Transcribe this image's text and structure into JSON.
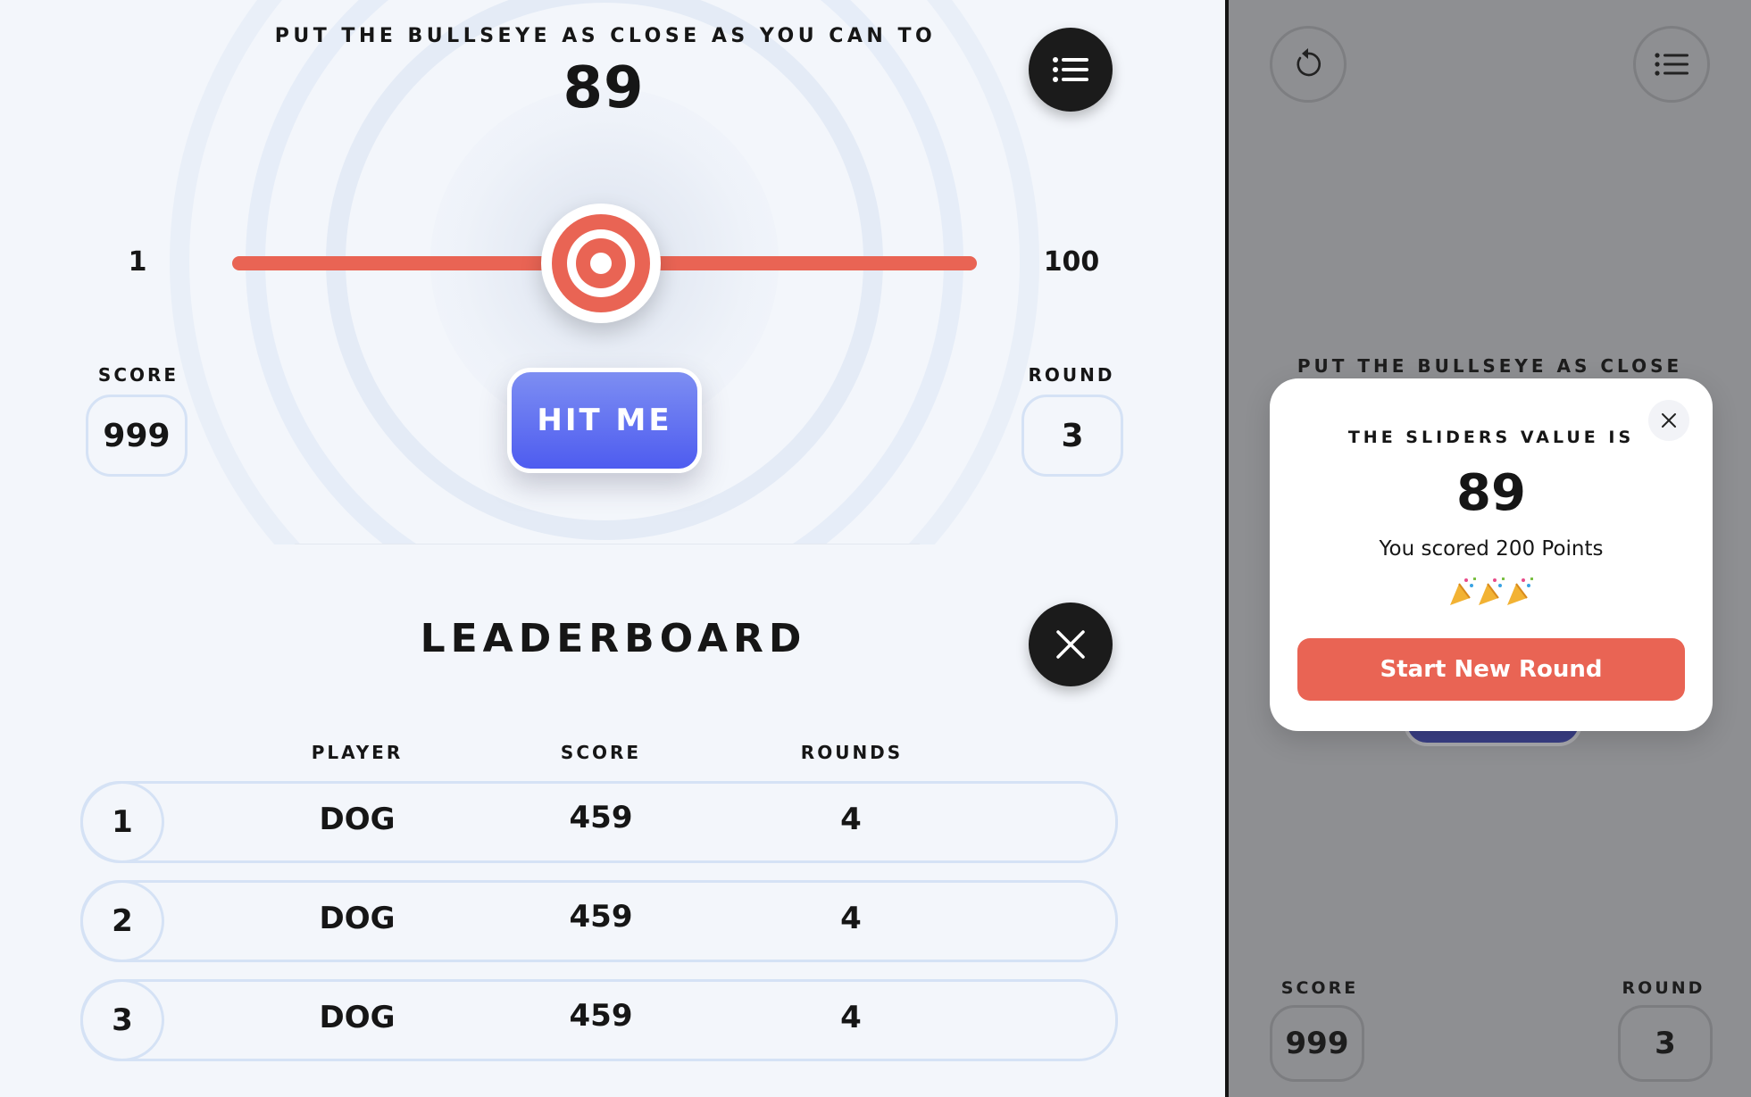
{
  "game": {
    "instruction": "PUT THE BULLSEYE AS CLOSE AS YOU CAN TO",
    "target": "89",
    "slider": {
      "min_label": "1",
      "max_label": "100",
      "value": 50
    },
    "score_label": "SCORE",
    "score_value": "999",
    "round_label": "ROUND",
    "round_value": "3",
    "hit_button": "HIT ME",
    "menu_icon": "list-icon"
  },
  "leaderboard": {
    "title": "LEADERBOARD",
    "close_icon": "close-icon",
    "columns": [
      "PLAYER",
      "SCORE",
      "ROUNDS"
    ],
    "rows": [
      {
        "rank": "1",
        "player": "DOG",
        "score": "459",
        "rounds": "4"
      },
      {
        "rank": "2",
        "player": "DOG",
        "score": "459",
        "rounds": "4"
      },
      {
        "rank": "3",
        "player": "DOG",
        "score": "459",
        "rounds": "4"
      }
    ]
  },
  "overlay": {
    "instruction": "PUT THE BULLSEYE AS CLOSE",
    "score_label": "SCORE",
    "score_value": "999",
    "round_label": "ROUND",
    "round_value": "3",
    "restart_icon": "restart-icon",
    "menu_icon": "list-icon"
  },
  "modal": {
    "title": "THE SLIDERS VALUE IS",
    "value": "89",
    "message": "You scored 200 Points",
    "confetti_icon": "party-popper-icon",
    "button": "Start New Round"
  },
  "colors": {
    "accent_red": "#e96454",
    "button_blue": "#4e5cf0",
    "background": "#f3f6fb",
    "border": "#d5e2f5"
  }
}
